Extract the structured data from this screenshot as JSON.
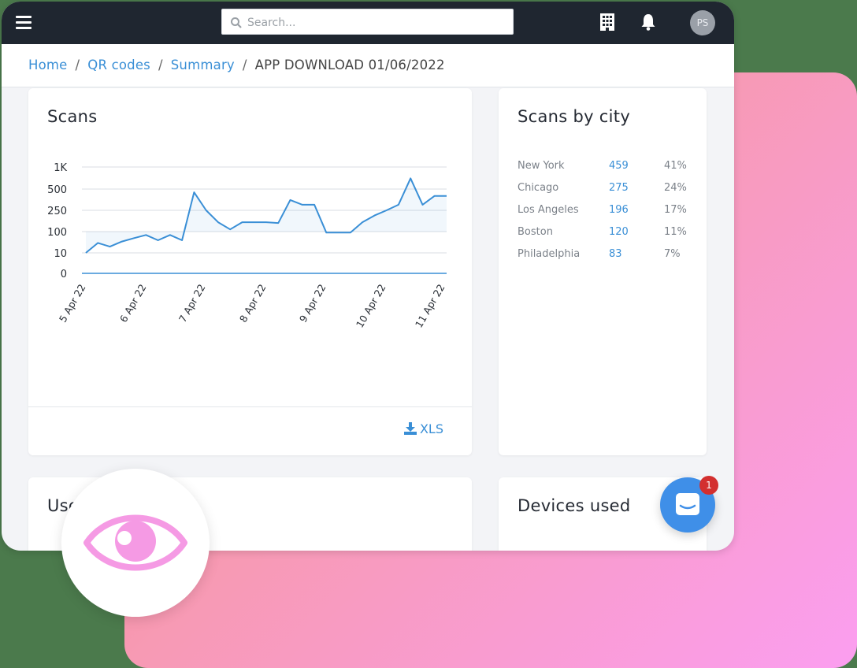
{
  "search": {
    "placeholder": "Search..."
  },
  "header": {
    "avatar_initials": "PS"
  },
  "breadcrumb": {
    "items": [
      "Home",
      "QR codes",
      "Summary"
    ],
    "current": "APP DOWNLOAD 01/06/2022"
  },
  "scans_card": {
    "title": "Scans",
    "export_label": "XLS"
  },
  "chart_data": {
    "type": "line",
    "y_ticks": [
      "1K",
      "500",
      "250",
      "100",
      "10",
      "0"
    ],
    "x_ticks": [
      "5 Apr 22",
      "6 Apr 22",
      "7 Apr 22",
      "8 Apr 22",
      "9 Apr 22",
      "10 Apr 22",
      "11 Apr 22"
    ],
    "series": [
      {
        "values": [
          10,
          30,
          20,
          35,
          50,
          70,
          40,
          70,
          40,
          450,
          250,
          150,
          110,
          150,
          150,
          150,
          145,
          350,
          300,
          300,
          90,
          90,
          90,
          150,
          200,
          250,
          300,
          700,
          300,
          400,
          400
        ]
      }
    ],
    "grid": true,
    "color": "#3a8fd6"
  },
  "city_card": {
    "title": "Scans by city",
    "rows": [
      {
        "city": "New York",
        "count": "459",
        "pct": "41%"
      },
      {
        "city": "Chicago",
        "count": "275",
        "pct": "24%"
      },
      {
        "city": "Los Angeles",
        "count": "196",
        "pct": "17%"
      },
      {
        "city": "Boston",
        "count": "120",
        "pct": "11%"
      },
      {
        "city": "Philadelphia",
        "count": "83",
        "pct": "7%"
      }
    ]
  },
  "users_card": {
    "title": "Use"
  },
  "devices_card": {
    "title": "Devices used"
  },
  "chat": {
    "badge_count": "1"
  },
  "colors": {
    "accent": "#3a8fd6",
    "topbar": "#1f2630",
    "eye": "#f59ae4",
    "chat": "#3f8fe8",
    "badge": "#d32f2f"
  },
  "icons": [
    "menu-icon",
    "search-icon",
    "building-icon",
    "bell-icon",
    "download-icon",
    "eye-icon",
    "chat-icon"
  ]
}
